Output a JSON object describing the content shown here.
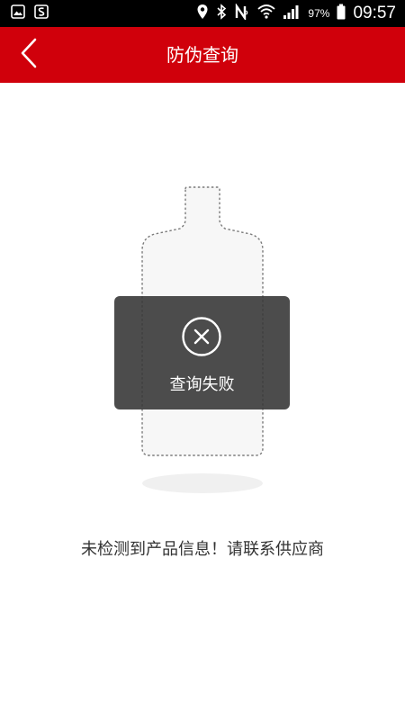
{
  "status_bar": {
    "battery_percent": "97%",
    "time": "09:57",
    "left_icons": [
      "image-icon",
      "s-app-icon"
    ],
    "right_icons": [
      "location-icon",
      "bluetooth-icon",
      "nfc-icon",
      "wifi-icon",
      "signal-icon",
      "battery-icon"
    ]
  },
  "header": {
    "title": "防伪查询",
    "background_color": "#d0000b",
    "back_icon": "chevron-left-icon"
  },
  "toast": {
    "message": "查询失败",
    "icon": "close-circle-icon"
  },
  "result_message": "未检测到产品信息！请联系供应商"
}
